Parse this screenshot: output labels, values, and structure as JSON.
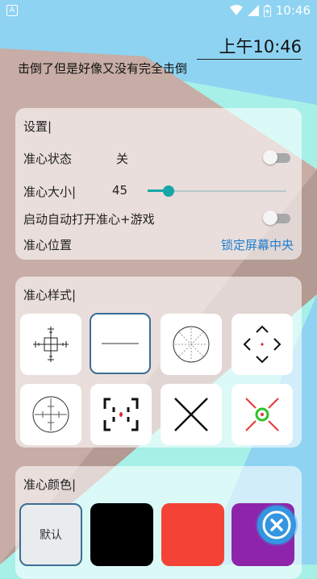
{
  "status_bar": {
    "app_icon_letter": "A",
    "time": "10:46",
    "icons": [
      "wifi-icon",
      "cellular-signal-icon",
      "battery-icon"
    ]
  },
  "overlay_clock": "上午10:46",
  "message": "击倒了但是好像又没有完全击倒",
  "settings_card": {
    "title": "设置|",
    "rows": {
      "state": {
        "label": "准心状态",
        "value": "关",
        "on": false
      },
      "size": {
        "label": "准心大小|",
        "value": "45",
        "level": 0.15
      },
      "autostart": {
        "label": "启动自动打开准心+游戏",
        "on": false
      },
      "position": {
        "label": "准心位置",
        "link": "锁定屏幕中央"
      }
    }
  },
  "style_card": {
    "title": "准心样式|",
    "styles": [
      {
        "icon": "crosshair-ticks-icon",
        "selected": false
      },
      {
        "icon": "crosshair-line-icon",
        "selected": true
      },
      {
        "icon": "crosshair-circle-grid-icon",
        "selected": false
      },
      {
        "icon": "crosshair-diamond-icon",
        "selected": false
      },
      {
        "icon": "crosshair-scope-icon",
        "selected": false
      },
      {
        "icon": "crosshair-brackets-icon",
        "selected": false
      },
      {
        "icon": "crosshair-x-icon",
        "selected": false
      },
      {
        "icon": "crosshair-green-dot-icon",
        "selected": false
      }
    ]
  },
  "color_card": {
    "title": "准心颜色|",
    "swatches": [
      {
        "label": "默认",
        "color": "#e9ecef",
        "selected": true
      },
      {
        "label": "",
        "color": "#000000",
        "selected": false
      },
      {
        "label": "",
        "color": "#f44336",
        "selected": false
      },
      {
        "label": "",
        "color": "#8e24aa",
        "selected": false
      }
    ]
  },
  "colors": {
    "accent": "#16a6a6",
    "link": "#1e7fd0",
    "fab": "#3496e0"
  },
  "fab_icon": "close-icon"
}
